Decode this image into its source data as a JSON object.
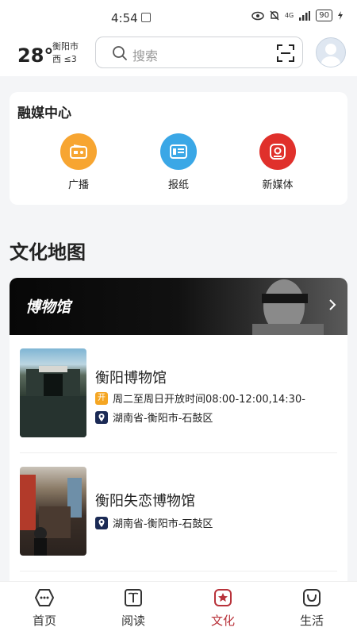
{
  "status": {
    "time": "4:54",
    "network": "4G",
    "battery": "90"
  },
  "header": {
    "temperature": "28°",
    "city": "衡阳市",
    "wind_dir": "西",
    "wind_level": "≤3",
    "search_placeholder": "搜索"
  },
  "media_center": {
    "title": "融媒中心",
    "items": [
      {
        "label": "广播",
        "icon": "radio-icon",
        "color": "#f7a531"
      },
      {
        "label": "报纸",
        "icon": "newspaper-icon",
        "color": "#3aa7e6"
      },
      {
        "label": "新媒体",
        "icon": "new-media-icon",
        "color": "#e0302b"
      }
    ]
  },
  "culture_map": {
    "title": "文化地图",
    "banner_label": "博物馆",
    "museums": [
      {
        "name": "衡阳博物馆",
        "open_tag": "开",
        "hours": "周二至周日开放时间08:00-12:00,14:30-",
        "location": "湖南省-衡阳市-石鼓区"
      },
      {
        "name": "衡阳失恋博物馆",
        "location": "湖南省-衡阳市-石鼓区"
      }
    ]
  },
  "tabs": [
    {
      "label": "首页",
      "icon": "home-icon"
    },
    {
      "label": "阅读",
      "icon": "book-icon"
    },
    {
      "label": "文化",
      "icon": "culture-icon",
      "active": true
    },
    {
      "label": "生活",
      "icon": "life-icon"
    }
  ],
  "colors": {
    "accent": "#b8323a",
    "background": "#f4f5f7"
  }
}
